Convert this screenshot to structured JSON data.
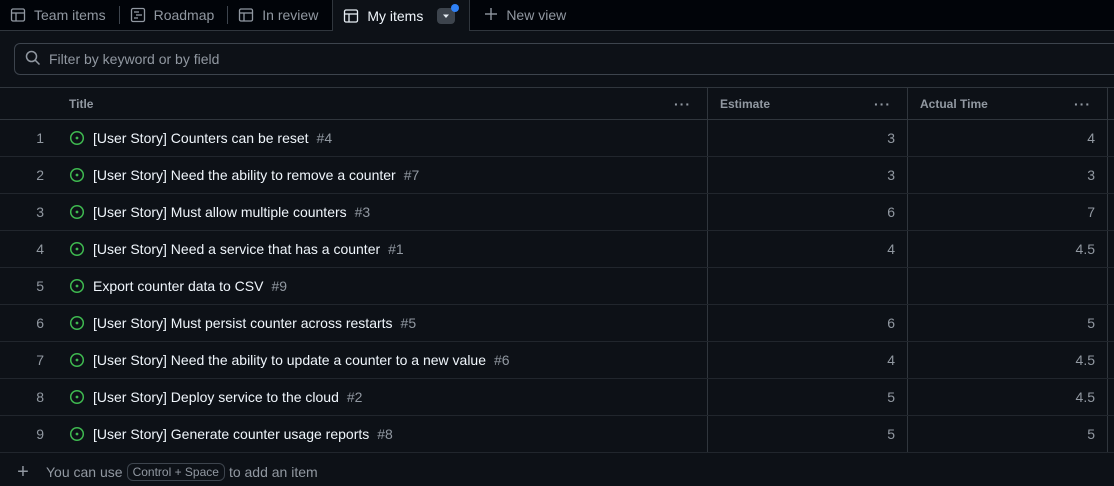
{
  "tabs": [
    {
      "label": "Team items"
    },
    {
      "label": "Roadmap"
    },
    {
      "label": "In review"
    },
    {
      "label": "My items"
    }
  ],
  "new_view_label": "New view",
  "filter": {
    "placeholder": "Filter by keyword or by field"
  },
  "columns": {
    "title": "Title",
    "estimate": "Estimate",
    "actual": "Actual Time"
  },
  "rows": [
    {
      "n": "1",
      "title": "[User Story] Counters can be reset",
      "num": "#4",
      "estimate": "3",
      "actual": "4"
    },
    {
      "n": "2",
      "title": "[User Story] Need the ability to remove a counter",
      "num": "#7",
      "estimate": "3",
      "actual": "3"
    },
    {
      "n": "3",
      "title": "[User Story] Must allow multiple counters",
      "num": "#3",
      "estimate": "6",
      "actual": "7"
    },
    {
      "n": "4",
      "title": "[User Story] Need a service that has a counter",
      "num": "#1",
      "estimate": "4",
      "actual": "4.5"
    },
    {
      "n": "5",
      "title": "Export counter data to CSV",
      "num": "#9",
      "estimate": "",
      "actual": ""
    },
    {
      "n": "6",
      "title": "[User Story] Must persist counter across restarts",
      "num": "#5",
      "estimate": "6",
      "actual": "5"
    },
    {
      "n": "7",
      "title": "[User Story] Need the ability to update a counter to a new value",
      "num": "#6",
      "estimate": "4",
      "actual": "4.5"
    },
    {
      "n": "8",
      "title": "[User Story] Deploy service to the cloud",
      "num": "#2",
      "estimate": "5",
      "actual": "4.5"
    },
    {
      "n": "9",
      "title": "[User Story] Generate counter usage reports",
      "num": "#8",
      "estimate": "5",
      "actual": "5"
    }
  ],
  "footer": {
    "prefix": "You can use",
    "shortcut": "Control + Space",
    "suffix": "to add an item"
  },
  "colors": {
    "open_issue": "#3fb950",
    "unsaved_dot": "#2f81f7"
  }
}
